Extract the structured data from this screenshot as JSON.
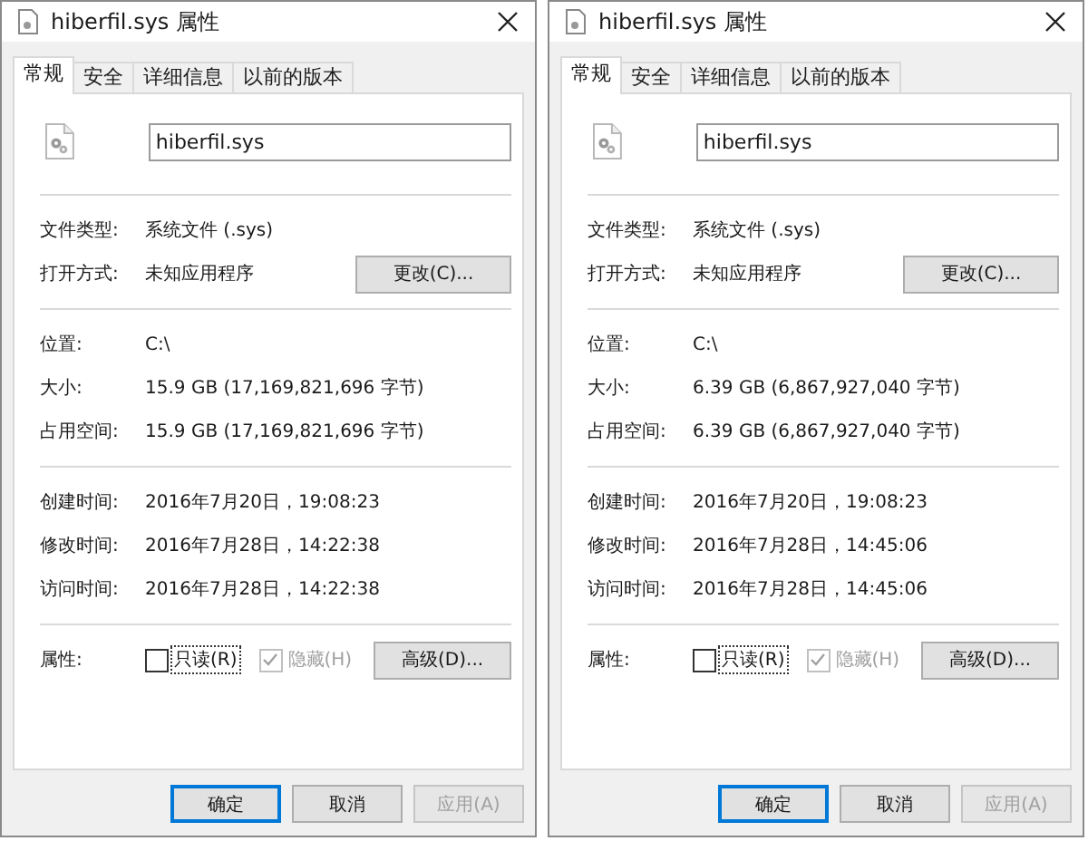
{
  "dialogs": [
    {
      "title": "hiberfil.sys 属性",
      "tabs": [
        {
          "label": "常规",
          "selected": true
        },
        {
          "label": "安全",
          "selected": false
        },
        {
          "label": "详细信息",
          "selected": false
        },
        {
          "label": "以前的版本",
          "selected": false
        }
      ],
      "file_name": "hiberfil.sys",
      "sections": [
        {
          "rows": [
            {
              "label": "文件类型:",
              "value": "系统文件 (.sys)"
            },
            {
              "label": "打开方式:",
              "value": "未知应用程序",
              "button": "更改(C)..."
            }
          ]
        },
        {
          "rows": [
            {
              "label": "位置:",
              "value": "C:\\"
            },
            {
              "label": "大小:",
              "value": "15.9 GB (17,169,821,696 字节)"
            },
            {
              "label": "占用空间:",
              "value": "15.9 GB (17,169,821,696 字节)"
            }
          ]
        },
        {
          "rows": [
            {
              "label": "创建时间:",
              "value": "2016年7月20日，19:08:23"
            },
            {
              "label": "修改时间:",
              "value": "2016年7月28日，14:22:38"
            },
            {
              "label": "访问时间:",
              "value": "2016年7月28日，14:22:38"
            }
          ]
        }
      ],
      "attributes": {
        "label": "属性:",
        "checkboxes": [
          {
            "label": "只读(R)",
            "checked": false,
            "disabled": false,
            "focused": true
          },
          {
            "label": "隐藏(H)",
            "checked": true,
            "disabled": true,
            "focused": false
          }
        ],
        "button": "高级(D)..."
      },
      "buttons": [
        {
          "label": "确定",
          "default": true,
          "disabled": false
        },
        {
          "label": "取消",
          "default": false,
          "disabled": false
        },
        {
          "label": "应用(A)",
          "default": false,
          "disabled": true
        }
      ]
    },
    {
      "title": "hiberfil.sys 属性",
      "tabs": [
        {
          "label": "常规",
          "selected": true
        },
        {
          "label": "安全",
          "selected": false
        },
        {
          "label": "详细信息",
          "selected": false
        },
        {
          "label": "以前的版本",
          "selected": false
        }
      ],
      "file_name": "hiberfil.sys",
      "sections": [
        {
          "rows": [
            {
              "label": "文件类型:",
              "value": "系统文件 (.sys)"
            },
            {
              "label": "打开方式:",
              "value": "未知应用程序",
              "button": "更改(C)..."
            }
          ]
        },
        {
          "rows": [
            {
              "label": "位置:",
              "value": "C:\\"
            },
            {
              "label": "大小:",
              "value": "6.39 GB (6,867,927,040 字节)"
            },
            {
              "label": "占用空间:",
              "value": "6.39 GB (6,867,927,040 字节)"
            }
          ]
        },
        {
          "rows": [
            {
              "label": "创建时间:",
              "value": "2016年7月20日，19:08:23"
            },
            {
              "label": "修改时间:",
              "value": "2016年7月28日，14:45:06"
            },
            {
              "label": "访问时间:",
              "value": "2016年7月28日，14:45:06"
            }
          ]
        }
      ],
      "attributes": {
        "label": "属性:",
        "checkboxes": [
          {
            "label": "只读(R)",
            "checked": false,
            "disabled": false,
            "focused": true
          },
          {
            "label": "隐藏(H)",
            "checked": true,
            "disabled": true,
            "focused": false
          }
        ],
        "button": "高级(D)..."
      },
      "buttons": [
        {
          "label": "确定",
          "default": true,
          "disabled": false
        },
        {
          "label": "取消",
          "default": false,
          "disabled": false
        },
        {
          "label": "应用(A)",
          "default": false,
          "disabled": true
        }
      ]
    }
  ]
}
